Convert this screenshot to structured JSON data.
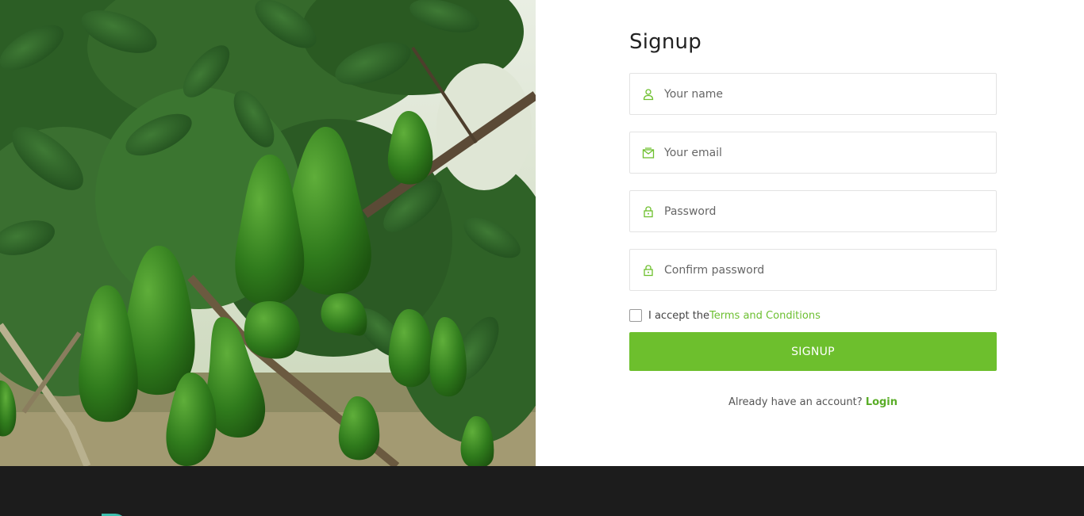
{
  "form": {
    "title": "Signup",
    "fields": [
      {
        "icon": "user-icon",
        "placeholder": "Your name",
        "value": ""
      },
      {
        "icon": "email-icon",
        "placeholder": "Your email",
        "value": ""
      },
      {
        "icon": "lock-icon",
        "placeholder": "Password",
        "value": ""
      },
      {
        "icon": "lock-icon",
        "placeholder": "Confirm password",
        "value": ""
      }
    ],
    "terms_text": "I accept the",
    "terms_link": "Terms and Conditions",
    "submit_label": "SIGNUP",
    "login_prompt": "Already have an account?",
    "login_link": "Login"
  },
  "colors": {
    "accent": "#6dbf2d",
    "link": "#6cbf30",
    "footer_bg": "#1c1c1c",
    "footer_logo": "#3cbfae"
  }
}
